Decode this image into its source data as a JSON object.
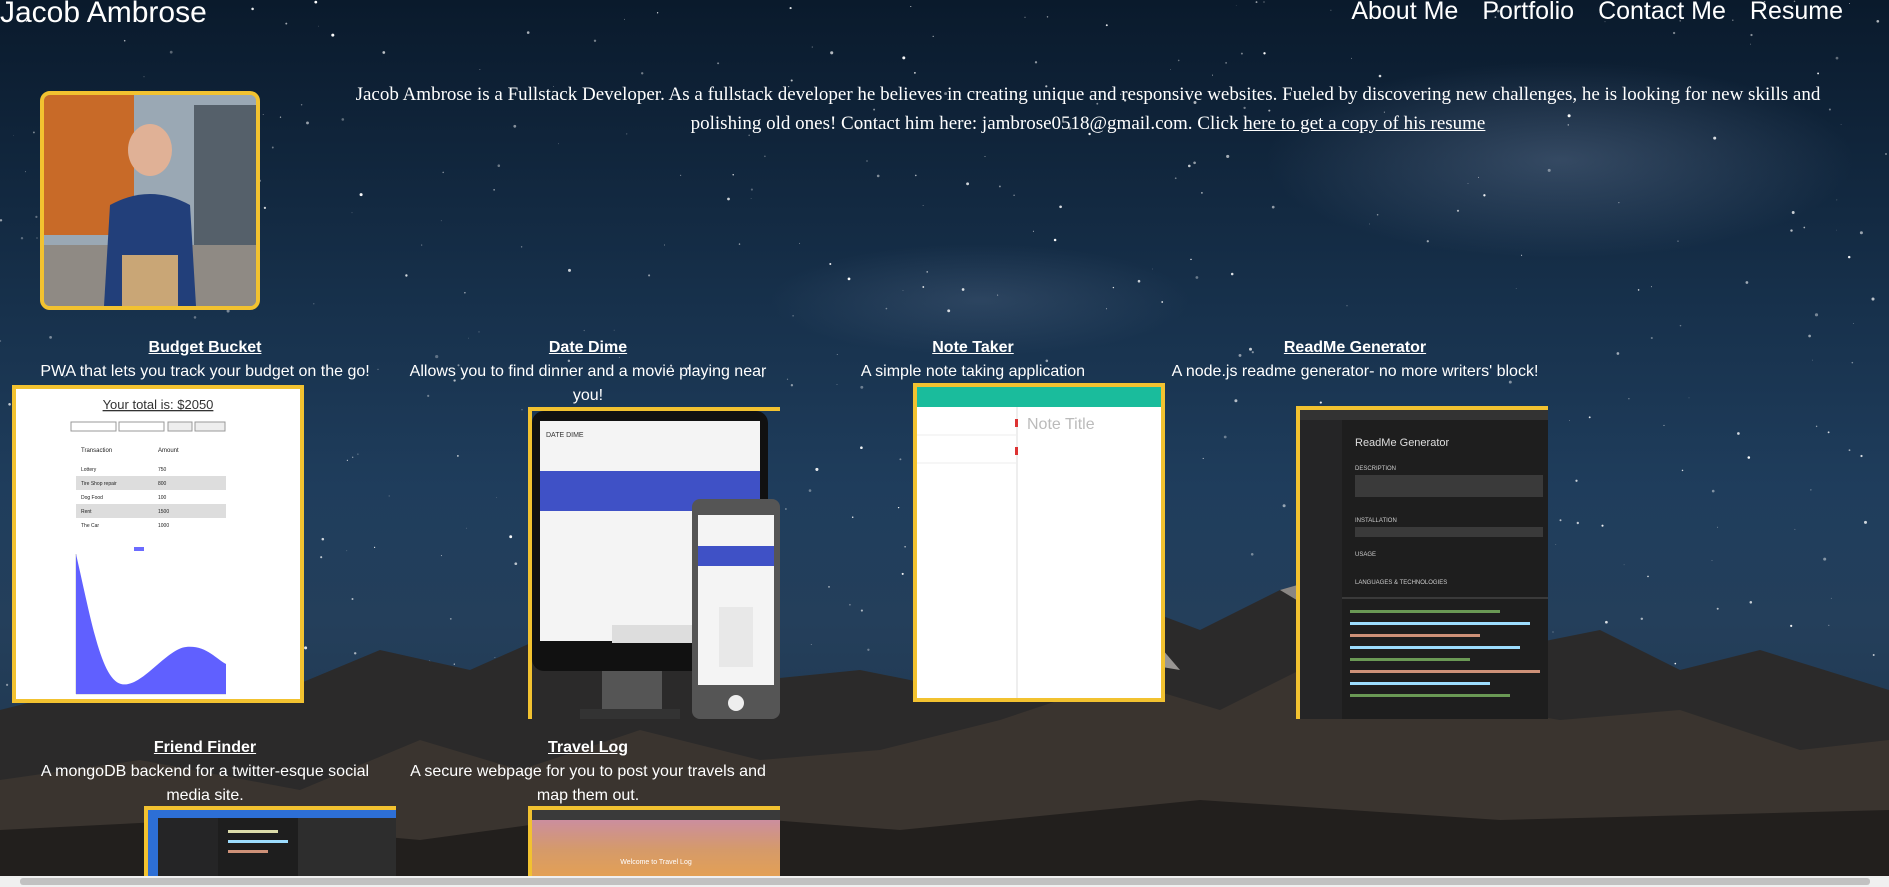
{
  "header": {
    "site_name": "Jacob Ambrose",
    "nav": [
      "About Me",
      "Portfolio",
      "Contact Me",
      "Resume"
    ]
  },
  "bio": {
    "text": "Jacob Ambrose is a Fullstack Developer. As a fullstack developer he believes in creating unique and responsive websites. Fueled by discovering new challenges, he is looking for new skills and polishing old ones! Contact him here: jambrose0518@gmail.com. Click ",
    "resume_link": "here to get a copy of his resume"
  },
  "projects": [
    {
      "title": "Budget Bucket",
      "description": "PWA that lets you track your budget on the go!"
    },
    {
      "title": "Date Dime",
      "description": "Allows you to find dinner and a movie playing near you!"
    },
    {
      "title": "Note Taker",
      "description": "A simple note taking application"
    },
    {
      "title": "ReadMe Generator",
      "description": "A node.js readme generator- no more writers' block!"
    },
    {
      "title": "Friend Finder",
      "description": "A mongoDB backend for a twitter-esque social media site."
    },
    {
      "title": "Travel Log",
      "description": "A secure webpage for you to post your travels and map them out."
    }
  ],
  "thumbnails": {
    "budget_total": "Your total is: $2050",
    "budget_table_headers": [
      "Transaction",
      "Amount"
    ],
    "budget_table_rows": [
      [
        "Lottery",
        "750"
      ],
      [
        "Tire Shop repair",
        "800"
      ],
      [
        "Dog Food",
        "100"
      ],
      [
        "Rent",
        "1500"
      ],
      [
        "The Car",
        "1000"
      ]
    ],
    "date_dime_logo": "DATE DIME",
    "note_title": "Note Title",
    "readme_heading": "ReadMe Generator",
    "readme_sections": [
      "DESCRIPTION",
      "INSTALLATION",
      "USAGE",
      "LANGUAGES & TECHNOLOGIES"
    ],
    "travel_log_heading": "Welcome to Travel Log"
  },
  "colors": {
    "accent_border": "#f2c230",
    "text": "#ffffff",
    "note_header": "#1abc9c"
  }
}
